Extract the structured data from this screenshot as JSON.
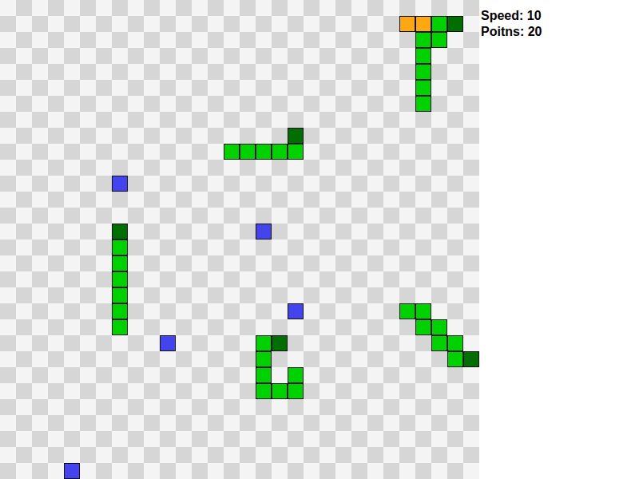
{
  "board": {
    "cols": 30,
    "rows": 30
  },
  "stats": [
    {
      "text": "Speed: 10"
    },
    {
      "text": "Poitns: 20"
    }
  ],
  "bonus": [
    {
      "col": 25,
      "row": 1
    },
    {
      "col": 26,
      "row": 1
    }
  ],
  "snakes": [
    {
      "segments": [
        {
          "col": 28,
          "row": 1,
          "head": true
        },
        {
          "col": 27,
          "row": 1,
          "head": false
        },
        {
          "col": 27,
          "row": 2,
          "head": false
        },
        {
          "col": 26,
          "row": 2,
          "head": false
        },
        {
          "col": 26,
          "row": 3,
          "head": false
        },
        {
          "col": 26,
          "row": 4,
          "head": false
        },
        {
          "col": 26,
          "row": 5,
          "head": false
        },
        {
          "col": 26,
          "row": 6,
          "head": false
        }
      ]
    },
    {
      "segments": [
        {
          "col": 18,
          "row": 8,
          "head": true
        },
        {
          "col": 18,
          "row": 9,
          "head": false
        },
        {
          "col": 17,
          "row": 9,
          "head": false
        },
        {
          "col": 16,
          "row": 9,
          "head": false
        },
        {
          "col": 15,
          "row": 9,
          "head": false
        },
        {
          "col": 14,
          "row": 9,
          "head": false
        }
      ]
    },
    {
      "segments": [
        {
          "col": 7,
          "row": 14,
          "head": true
        },
        {
          "col": 7,
          "row": 15,
          "head": false
        },
        {
          "col": 7,
          "row": 16,
          "head": false
        },
        {
          "col": 7,
          "row": 17,
          "head": false
        },
        {
          "col": 7,
          "row": 18,
          "head": false
        },
        {
          "col": 7,
          "row": 19,
          "head": false
        },
        {
          "col": 7,
          "row": 20,
          "head": false
        }
      ]
    },
    {
      "segments": [
        {
          "col": 17,
          "row": 21,
          "head": true
        },
        {
          "col": 16,
          "row": 21,
          "head": false
        },
        {
          "col": 16,
          "row": 22,
          "head": false
        },
        {
          "col": 16,
          "row": 23,
          "head": false
        },
        {
          "col": 16,
          "row": 24,
          "head": false
        },
        {
          "col": 17,
          "row": 24,
          "head": false
        },
        {
          "col": 18,
          "row": 24,
          "head": false
        },
        {
          "col": 18,
          "row": 23,
          "head": false
        }
      ]
    },
    {
      "segments": [
        {
          "col": 29,
          "row": 22,
          "head": true
        },
        {
          "col": 28,
          "row": 22,
          "head": false
        },
        {
          "col": 28,
          "row": 21,
          "head": false
        },
        {
          "col": 27,
          "row": 21,
          "head": false
        },
        {
          "col": 27,
          "row": 20,
          "head": false
        },
        {
          "col": 26,
          "row": 20,
          "head": false
        },
        {
          "col": 26,
          "row": 19,
          "head": false
        },
        {
          "col": 25,
          "row": 19,
          "head": false
        }
      ]
    }
  ],
  "food": [
    {
      "col": 7,
      "row": 11
    },
    {
      "col": 16,
      "row": 14
    },
    {
      "col": 18,
      "row": 19
    },
    {
      "col": 10,
      "row": 21
    },
    {
      "col": 4,
      "row": 29
    }
  ]
}
